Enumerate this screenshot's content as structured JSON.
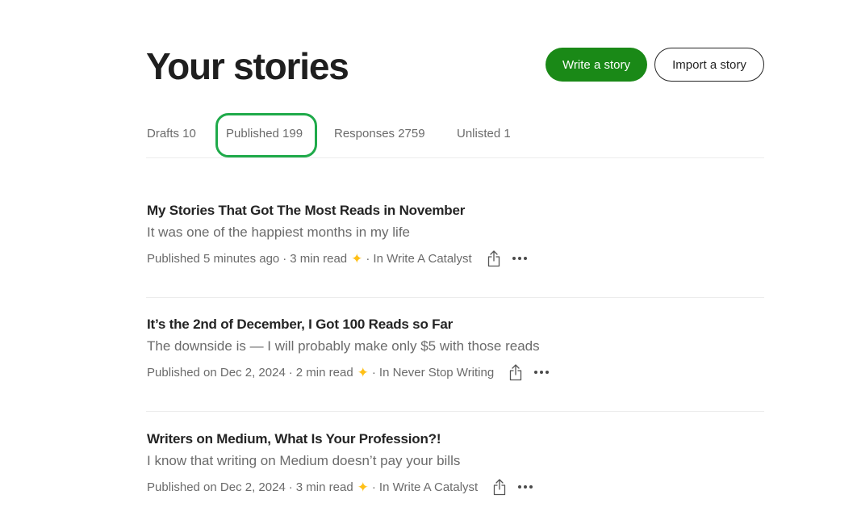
{
  "header": {
    "title": "Your stories",
    "write_label": "Write a story",
    "import_label": "Import a story"
  },
  "tabs": [
    {
      "label": "Drafts 10"
    },
    {
      "label": "Published 199",
      "highlighted": true
    },
    {
      "label": "Responses 2759"
    },
    {
      "label": "Unlisted 1"
    }
  ],
  "stories": [
    {
      "title": "My Stories That Got The Most Reads in November",
      "subtitle": "It was one of the happiest months in my life",
      "published": "Published 5 minutes ago",
      "read_time": "3 min read",
      "publication": "In Write A Catalyst"
    },
    {
      "title": "It’s the 2nd of December, I Got 100 Reads so Far",
      "subtitle": "The downside is — I will probably make only $5 with those reads",
      "published": "Published on Dec 2, 2024",
      "read_time": "2 min read",
      "publication": "In Never Stop Writing"
    },
    {
      "title": "Writers on Medium, What Is Your Profession?!",
      "subtitle": "I know that writing on Medium doesn’t pay your bills",
      "published": "Published on Dec 2, 2024",
      "read_time": "3 min read",
      "publication": "In Write A Catalyst"
    }
  ],
  "meta": {
    "separator": "·"
  },
  "colors": {
    "brand_green": "#1a8917",
    "highlight_green": "#1faa4a",
    "star": "#ffc017"
  }
}
